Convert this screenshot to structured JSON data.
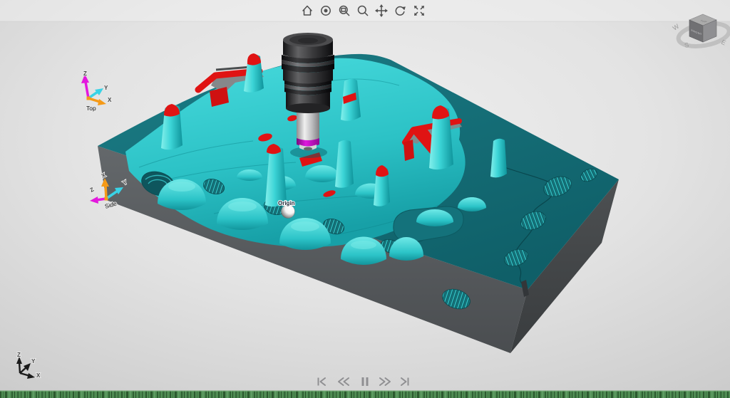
{
  "viewport": {
    "description": "CAM machining simulation 3D viewport"
  },
  "toolbar": {
    "items": [
      {
        "name": "home"
      },
      {
        "name": "visibility"
      },
      {
        "name": "zoom-window"
      },
      {
        "name": "zoom"
      },
      {
        "name": "pan"
      },
      {
        "name": "rotate"
      },
      {
        "name": "fit-view"
      }
    ]
  },
  "view_cube": {
    "top": "TOP",
    "front": "FRONT",
    "compass": {
      "w": "W",
      "s": "S",
      "e": "E"
    }
  },
  "triads": {
    "top": {
      "label": "Top",
      "x": "X",
      "y": "Y",
      "z": "Z"
    },
    "side": {
      "label": "Side",
      "x": "X",
      "y": "Y",
      "z": "Z"
    },
    "corner": {
      "x": "X",
      "y": "Y",
      "z": "Z"
    }
  },
  "scene": {
    "origin_label": "Origin",
    "colors": {
      "stock_top": "#15707a",
      "machined_surface": "#35d2d5",
      "excess_material": "#e01313",
      "stock_front_face": "#5d6164",
      "stock_side_face": "#45484a",
      "tool_holder": "#3a3a3c",
      "tool_shank": "#c9c9cb",
      "tool_tip_ring": "#c213c4",
      "timeline_green": "#4f8c53"
    }
  },
  "playback": {
    "buttons": [
      {
        "name": "skip-to-start"
      },
      {
        "name": "step-back"
      },
      {
        "name": "pause"
      },
      {
        "name": "step-forward"
      },
      {
        "name": "skip-to-end"
      }
    ]
  }
}
